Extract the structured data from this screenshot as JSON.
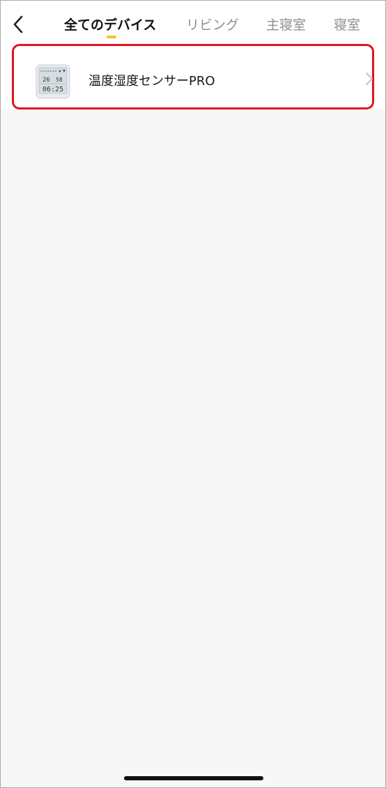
{
  "header": {
    "back_icon": "chevron-left-icon",
    "tabs": [
      {
        "label": "全てのデバイス",
        "active": true
      },
      {
        "label": "リビング",
        "active": false
      },
      {
        "label": "主寝室",
        "active": false
      },
      {
        "label": "寝室",
        "active": false
      }
    ],
    "indicator_color": "#f2c12e"
  },
  "devices": [
    {
      "name": "温度湿度センサーPRO",
      "icon": "thermo-hygrometer-device-icon",
      "thumbnail_readouts": {
        "temperature": "26",
        "humidity": "58",
        "time": "06:25"
      }
    }
  ],
  "highlight_color": "#e0141e",
  "chevron_icon": "chevron-right-icon"
}
